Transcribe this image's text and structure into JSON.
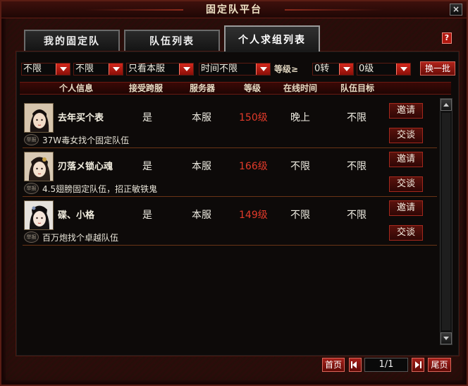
{
  "window": {
    "title": "固定队平台",
    "close_icon": "×"
  },
  "tabs": [
    {
      "label": "我的固定队",
      "active": false
    },
    {
      "label": "队伍列表",
      "active": false
    },
    {
      "label": "个人求组列表",
      "active": true
    }
  ],
  "help": {
    "label": "?"
  },
  "filters": {
    "filter1": "不限",
    "filter2": "不限",
    "server": "只看本服",
    "time": "时间不限",
    "level_label": "等级≥",
    "rebirth": "0转",
    "level": "0级",
    "refresh_label": "换一批"
  },
  "columns": [
    "个人信息",
    "接受跨服",
    "服务器",
    "等级",
    "在线时间",
    "队伍目标"
  ],
  "rows": [
    {
      "name": "去年买个表",
      "cross": "是",
      "server": "本服",
      "level": "150级",
      "online": "晚上",
      "goal": "不限",
      "message": "37W毒女找个固定队伍",
      "invite": "邀请",
      "chat": "交谈",
      "report": "举报"
    },
    {
      "name": "刃落メ锁心魂",
      "cross": "是",
      "server": "本服",
      "level": "166级",
      "online": "不限",
      "goal": "不限",
      "message": "4.5翅膀固定队伍，招正敏铁鬼",
      "invite": "邀请",
      "chat": "交谈",
      "report": "举报"
    },
    {
      "name": "碟、小格",
      "cross": "是",
      "server": "本服",
      "level": "149级",
      "online": "不限",
      "goal": "不限",
      "message": "百万炮找个卓越队伍",
      "invite": "邀请",
      "chat": "交谈",
      "report": "举报"
    }
  ],
  "pager": {
    "first": "首页",
    "last": "尾页",
    "page": "1/1"
  },
  "colors": {
    "accent": "#b0231a",
    "level_text": "#e23a2a",
    "background": "#2a0c0a"
  }
}
